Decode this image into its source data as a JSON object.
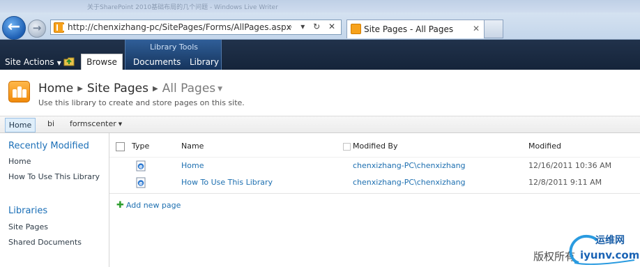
{
  "browser": {
    "window_title": "关于SharePoint 2010基础布局的几个问题 - Windows Live Writer",
    "address": "http://chenxizhang-pc/SitePages/Forms/AllPages.aspx",
    "address_icons": "⌕ ▾ ↻ ✕",
    "active_tab_title": "Site Pages - All Pages",
    "tab_close": "✕",
    "back_glyph": "←",
    "forward_glyph": "→"
  },
  "ribbon": {
    "site_actions": "Site Actions",
    "browse_tab": "Browse",
    "context_group": "Library Tools",
    "documents_tab": "Documents",
    "library_tab": "Library"
  },
  "title_area": {
    "crumb_home": "Home",
    "crumb_site_pages": "Site Pages",
    "crumb_current": "All Pages",
    "description": "Use this library to create and store pages on this site."
  },
  "top_nav": {
    "items": [
      "Home",
      "bi",
      "formscenter"
    ]
  },
  "quick_launch": {
    "recent_heading": "Recently Modified",
    "recent_items": [
      "Home",
      "How To Use This Library"
    ],
    "libraries_heading": "Libraries",
    "library_items": [
      "Site Pages",
      "Shared Documents"
    ]
  },
  "list": {
    "columns": {
      "type": "Type",
      "name": "Name",
      "modified_by": "Modified By",
      "modified": "Modified"
    },
    "rows": [
      {
        "name": "Home",
        "modified_by": "chenxizhang-PC\\chenxizhang",
        "modified": "12/16/2011 10:36 AM"
      },
      {
        "name": "How To Use This Library",
        "modified_by": "chenxizhang-PC\\chenxizhang",
        "modified": "12/8/2011 9:11 AM"
      }
    ],
    "add_new": "Add new page"
  },
  "watermark": {
    "text": "版权所有 ",
    "logo_cn": "运维网",
    "logo_en": "iyunv.com"
  },
  "colors": {
    "ribbon_bg": "#1a2b43",
    "link": "#1d6fb0",
    "accent_orange": "#f7a21c",
    "quick_launch_heading": "#1b6fb7"
  },
  "icons": {
    "favicon": "sharepoint-favicon",
    "row_type": "ie-page-icon",
    "navigate_up": "folder-up-icon",
    "add": "plus-icon"
  }
}
